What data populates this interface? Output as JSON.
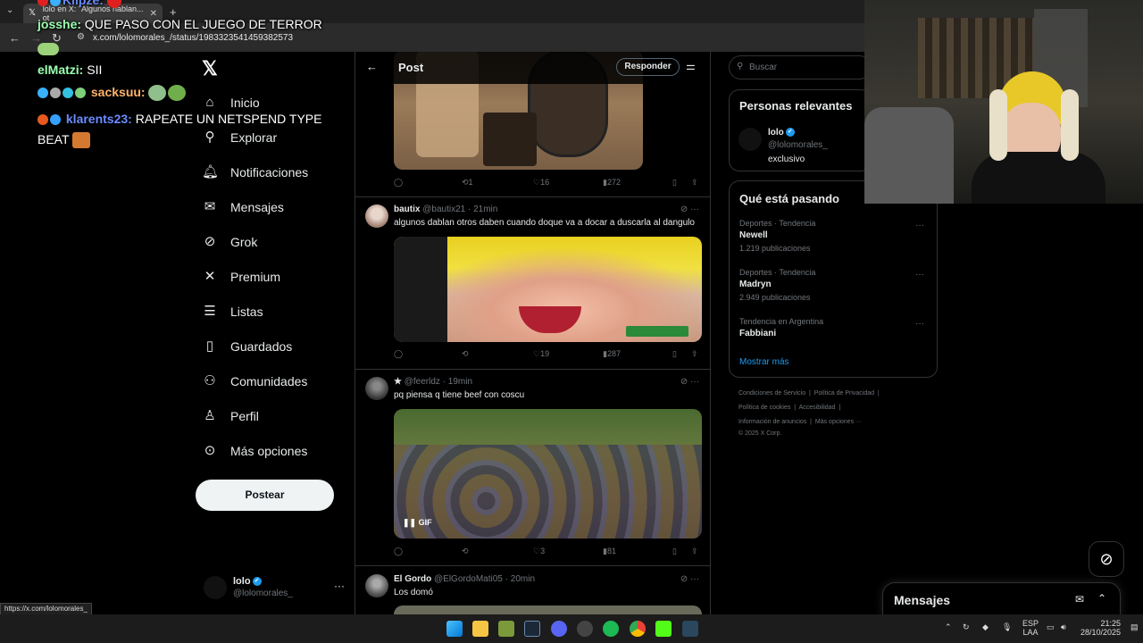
{
  "browser": {
    "tab_title": "lolo en X: \"Algunos hablan... ot",
    "url": "x.com/lolomorales_/status/1983323541459382573"
  },
  "chat": {
    "line0_user": "Klipze:",
    "line1_user": "josshe:",
    "line1_text": "QUE PASO CON EL JUEGO DE TERROR",
    "line2_user": "elMatzi:",
    "line2_text": "SII",
    "line3_user": "sacksuu:",
    "line4_user": "klarents23:",
    "line4_text": "RAPEATE UN NETSPEND TYPE",
    "line5_text": "BEAT"
  },
  "nav": {
    "items": [
      {
        "label": "Inicio",
        "icon": "home-icon"
      },
      {
        "label": "Explorar",
        "icon": "search-icon"
      },
      {
        "label": "Notificaciones",
        "icon": "bell-icon"
      },
      {
        "label": "Mensajes",
        "icon": "mail-icon"
      },
      {
        "label": "Grok",
        "icon": "grok-icon"
      },
      {
        "label": "Premium",
        "icon": "x-icon"
      },
      {
        "label": "Listas",
        "icon": "list-icon"
      },
      {
        "label": "Guardados",
        "icon": "bookmark-icon"
      },
      {
        "label": "Comunidades",
        "icon": "people-icon"
      },
      {
        "label": "Perfil",
        "icon": "person-icon"
      },
      {
        "label": "Más opciones",
        "icon": "more-icon"
      }
    ],
    "post_button": "Postear",
    "account_name": "lolo",
    "account_handle": "@lolomorales_"
  },
  "post_header": {
    "title": "Post",
    "reply_button": "Responder"
  },
  "tweets": [
    {
      "replies": "",
      "retweets": "1",
      "likes": "16",
      "views": "272"
    },
    {
      "name": "bautix",
      "handle": "@bautix21",
      "time": "· 21min",
      "text": "algunos dablan otros daben cuando doque va a docar a duscarla al dangulo",
      "retweets": "",
      "likes": "19",
      "views": "287"
    },
    {
      "name": "",
      "handle": "@feerldz",
      "time": "· 19min",
      "text": "pq piensa q tiene beef con coscu",
      "gif_label": "GIF",
      "retweets": "",
      "likes": "3",
      "views": "81"
    },
    {
      "name": "El Gordo",
      "handle": "@ElGordoMati05",
      "time": "· 20min",
      "text": "Los domó"
    }
  ],
  "right": {
    "search_placeholder": "Buscar",
    "relevant_title": "Personas relevantes",
    "relevant_name": "lolo",
    "relevant_handle": "@lolomorales_",
    "relevant_bio": "exclusivo",
    "trends_title": "Qué está pasando",
    "trends": [
      {
        "category": "Deportes · Tendencia",
        "name": "Newell",
        "count": "1.219 publicaciones"
      },
      {
        "category": "Deportes · Tendencia",
        "name": "Madryn",
        "count": "2.949 publicaciones"
      },
      {
        "category": "Tendencia en Argentina",
        "name": "Fabbiani",
        "count": ""
      }
    ],
    "show_more": "Mostrar más",
    "footer": {
      "l1a": "Condiciones de Servicio",
      "l1b": "Política de Privacidad",
      "l2a": "Política de cookies",
      "l2b": "Accesibilidad",
      "l3a": "Información de anuncios",
      "l3b": "Más opciones ···",
      "l4": "© 2025 X Corp."
    }
  },
  "messages_drawer": {
    "title": "Mensajes"
  },
  "status_url": "https://x.com/lolomorales_",
  "taskbar": {
    "lang1": "ESP",
    "lang2": "LAA",
    "time": "21:25",
    "date": "28/10/2025"
  },
  "colors": {
    "accent": "#1d9bf0",
    "background": "#000000",
    "border": "#2f3336",
    "muted_text": "#71767b"
  }
}
